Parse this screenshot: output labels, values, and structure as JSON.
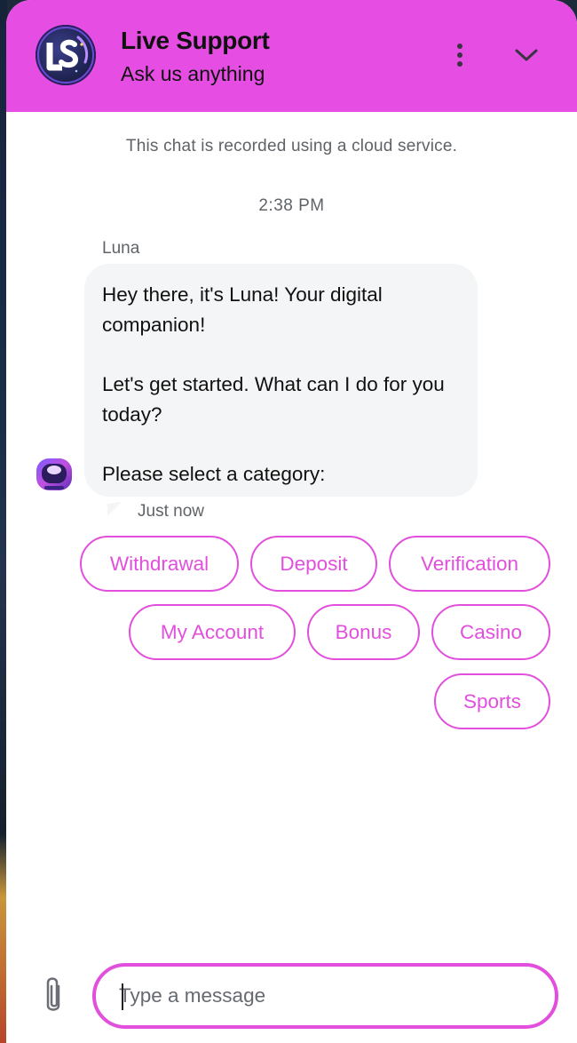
{
  "header": {
    "title": "Live Support",
    "subtitle": "Ask us anything",
    "logo_letters": "LS",
    "accent_color": "#e64de3",
    "icons": {
      "menu": "more-vertical-icon",
      "collapse": "chevron-down-icon"
    }
  },
  "chat": {
    "notice": "This chat is recorded using a cloud service.",
    "timestamp": "2:38 PM",
    "sender": "Luna",
    "message_lines": [
      "Hey there, it's Luna! Your digital companion!",
      "Let's get started. What can I do for you today?",
      "Please select a category:"
    ],
    "delivered": "Just now"
  },
  "categories": [
    "Withdrawal",
    "Deposit",
    "Verification",
    "My Account",
    "Bonus",
    "Casino",
    "Sports"
  ],
  "composer": {
    "placeholder": "Type a message",
    "value": "",
    "attach_icon": "paperclip-icon",
    "border_color": "#e24fdd"
  }
}
